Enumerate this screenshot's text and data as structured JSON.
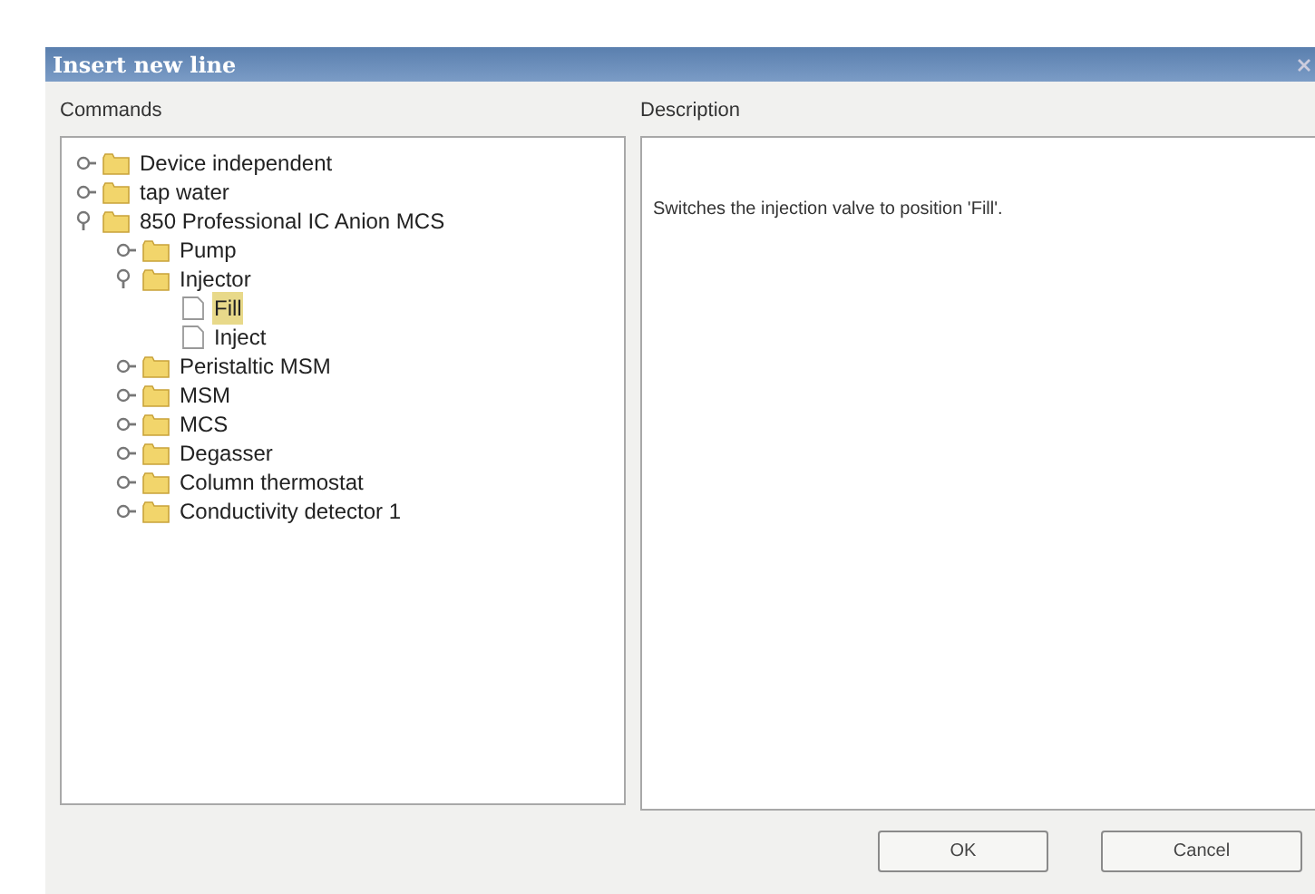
{
  "window": {
    "title": "Insert new line"
  },
  "commands": {
    "label": "Commands",
    "tree": [
      {
        "label": "Device independent",
        "kind": "folder",
        "expanded": false,
        "selected": false
      },
      {
        "label": "tap water",
        "kind": "folder",
        "expanded": false,
        "selected": false
      },
      {
        "label": "850 Professional IC Anion MCS",
        "kind": "folder",
        "expanded": true,
        "selected": false,
        "children": [
          {
            "label": "Pump",
            "kind": "folder",
            "expanded": false,
            "selected": false
          },
          {
            "label": "Injector",
            "kind": "folder",
            "expanded": true,
            "selected": false,
            "children": [
              {
                "label": "Fill",
                "kind": "document",
                "selected": true
              },
              {
                "label": "Inject",
                "kind": "document",
                "selected": false
              }
            ]
          },
          {
            "label": "Peristaltic MSM",
            "kind": "folder",
            "expanded": false,
            "selected": false
          },
          {
            "label": "MSM",
            "kind": "folder",
            "expanded": false,
            "selected": false
          },
          {
            "label": "MCS",
            "kind": "folder",
            "expanded": false,
            "selected": false
          },
          {
            "label": "Degasser",
            "kind": "folder",
            "expanded": false,
            "selected": false
          },
          {
            "label": "Column thermostat",
            "kind": "folder",
            "expanded": false,
            "selected": false
          },
          {
            "label": "Conductivity detector 1",
            "kind": "folder",
            "expanded": false,
            "selected": false
          }
        ]
      }
    ]
  },
  "description": {
    "label": "Description",
    "text": "Switches the injection valve to position 'Fill'."
  },
  "buttons": [
    "OK",
    "Cancel"
  ]
}
